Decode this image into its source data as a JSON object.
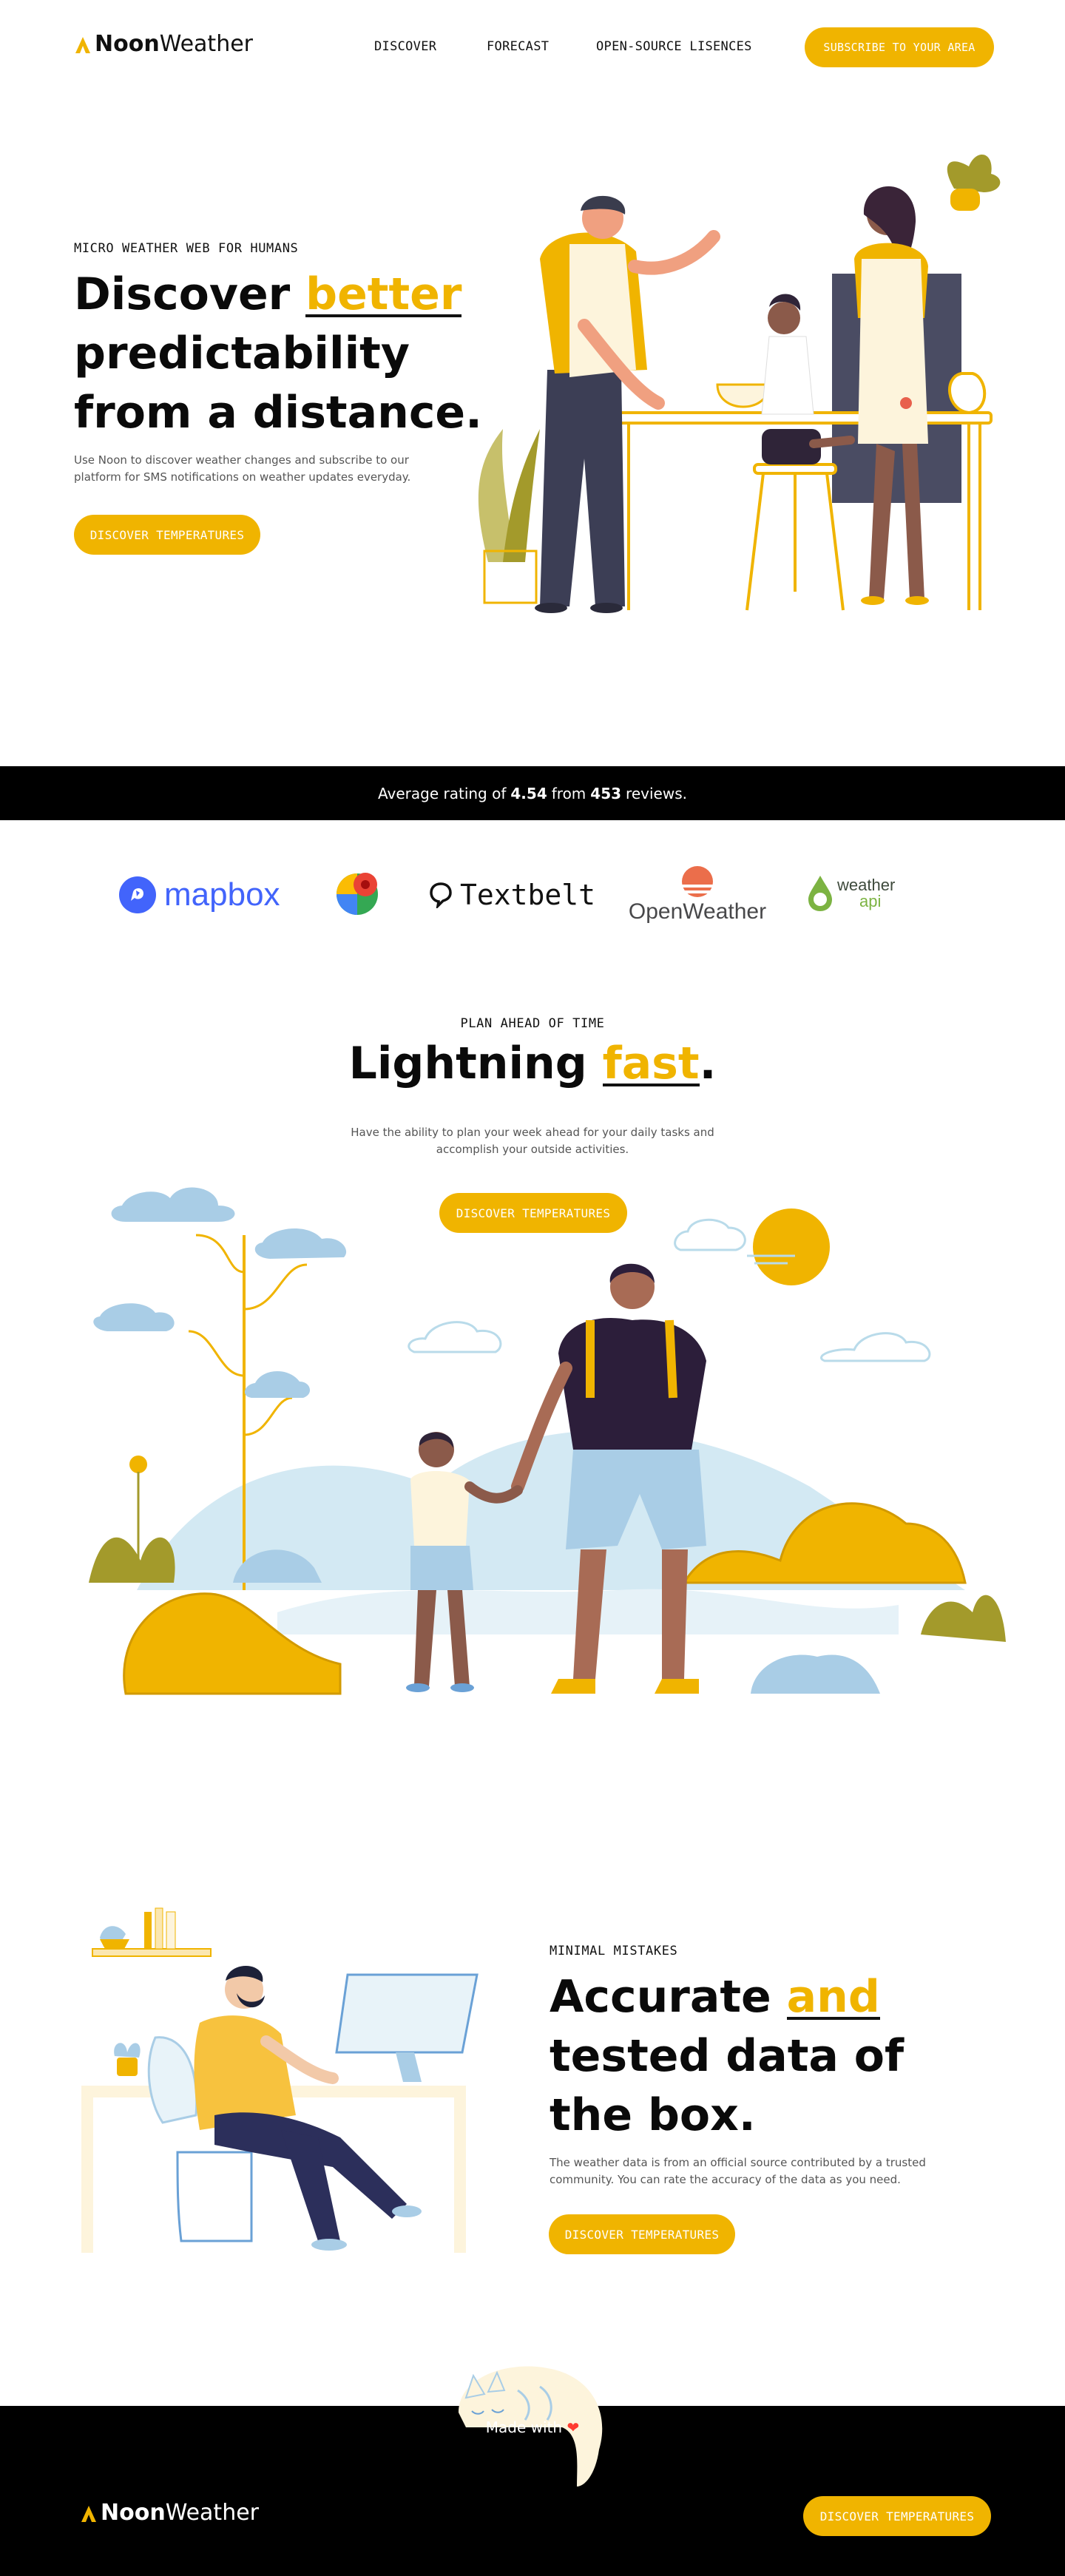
{
  "header": {
    "logo": {
      "bold": "Noon",
      "light": "Weather"
    },
    "nav": [
      "DISCOVER",
      "FORECAST",
      "OPEN-SOURCE LISENCES"
    ],
    "cta": "SUBSCRIBE TO YOUR AREA"
  },
  "hero": {
    "eyebrow": "MICRO WEATHER WEB FOR HUMANS",
    "title_pre": "Discover ",
    "title_hl": "better",
    "title_line2": "predictability",
    "title_line3": "from a distance.",
    "body": "Use Noon to discover weather changes and subscribe to our platform for SMS notifications on weather updates everyday.",
    "cta": "DISCOVER TEMPERATURES"
  },
  "rating": {
    "prefix": "Average rating of",
    "score": "4.54",
    "mid": "from",
    "count": "453",
    "suffix": "reviews."
  },
  "partners": {
    "mapbox": "mapbox",
    "textbelt": "Textbelt",
    "openweather": "OpenWeather",
    "weatherapi_1": "weather",
    "weatherapi_2": "api"
  },
  "section2": {
    "eyebrow": "PLAN AHEAD OF TIME",
    "title_pre": "Lightning ",
    "title_hl": "fast",
    "title_post": ".",
    "body_line1": "Have the ability to plan your week ahead for your daily tasks and",
    "body_line2": "accomplish your outside activities.",
    "cta": "DISCOVER TEMPERATURES"
  },
  "section3": {
    "eyebrow": "MINIMAL MISTAKES",
    "title_pre": "Accurate ",
    "title_hl": "and",
    "title_line2": "tested data of",
    "title_line3": "the box.",
    "body": "The weather data is from an official source contributed by a trusted community. You can rate the accuracy of the data as you need.",
    "cta": "DISCOVER TEMPERATURES"
  },
  "footer": {
    "made_with": "Made with",
    "heart": "❤",
    "logo": {
      "bold": "Noon",
      "light": "Weather"
    },
    "cta": "DISCOVER TEMPERATURES"
  },
  "colors": {
    "accent": "#f0b400",
    "black": "#000000",
    "light_blue": "#a9cde6",
    "navy": "#2c2f5b"
  }
}
